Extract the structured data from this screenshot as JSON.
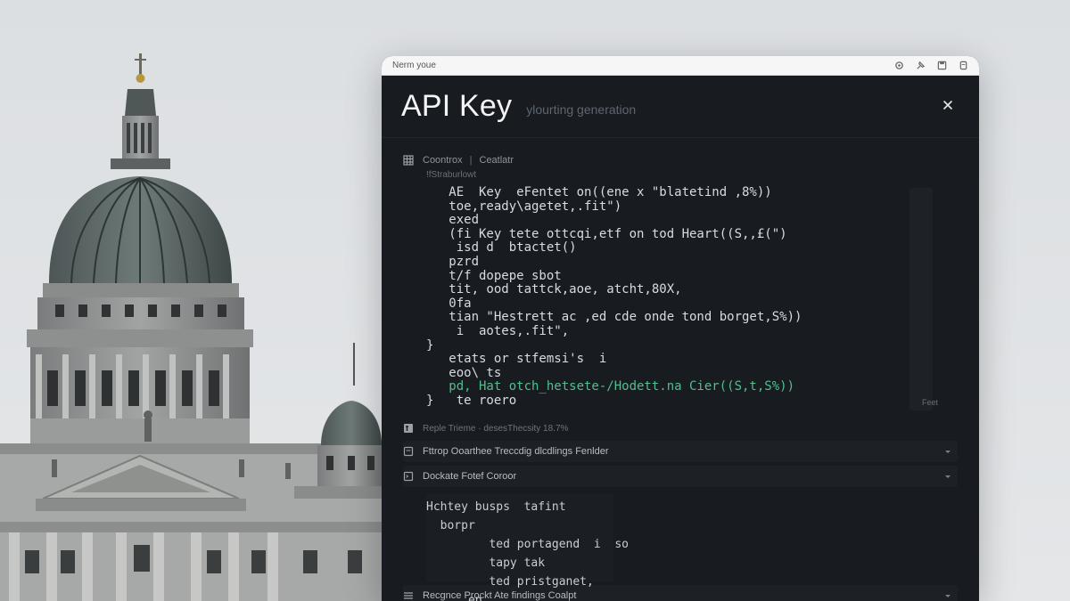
{
  "window": {
    "title": "Nerm youe",
    "icons": [
      "settings-icon",
      "pin-icon",
      "save-icon",
      "copy-icon"
    ]
  },
  "header": {
    "title": "API Key",
    "subtitle": "ylourting generation",
    "close_icon": "close-icon"
  },
  "section1": {
    "label": "Coontrox",
    "label2": "Ceatlatr",
    "sub_label": "!fStraburlowt",
    "code_lines": [
      "   AE  Key  eFentet on((ene x \"blatetind ,8%))",
      "   toe,ready\\agetet,.fit\")",
      "   exed",
      "   (fi Key tete ottcqi,etf on tod Heart((S,,£(\")",
      "    isd d  btactet()",
      "   pzrd",
      "   t/f dopepe sbot",
      "   tit, ood tattck,aoe, atcht,80X,",
      "   0fa",
      "   tian \"Hestrett ac ,ed cde onde tond borget,S%))",
      "    i  aotes,.fit\",",
      "}",
      "   etats or stfemsi's  i",
      "   eoo\\ ts",
      "   pd, Hat otch_hetsete-/Hodett.na Cier((S,t,S%))",
      "}   te roero"
    ],
    "highlight_line_index": 14,
    "badge": "Feet"
  },
  "meta": {
    "text": "Reple Trieme · desesThecsity 18.7%"
  },
  "accordions": [
    {
      "label": "Fttrop Ooarthee Treccdig dlcdlings Fenlder"
    },
    {
      "label": "Dockate Fotef Coroor"
    }
  ],
  "section2": {
    "code_lines": [
      "Hchtey busps  tafint",
      "  borpr",
      "         ted portagend  i  so",
      "         tapy tak",
      "         ted pristganet,",
      "      ep"
    ]
  },
  "footer_accordion": {
    "label": "Recgnce Prockt Ate findings Coalpt"
  },
  "colors": {
    "panel_bg": "#181b20",
    "accent": "#4fc08d",
    "titlebar_bg": "#f6f6f6"
  }
}
